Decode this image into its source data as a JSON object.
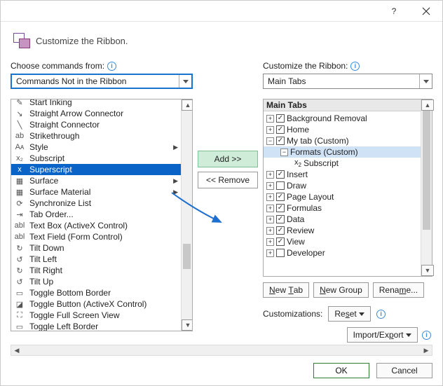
{
  "header": {
    "title": "Customize the Ribbon."
  },
  "labels": {
    "choose": "Choose commands from:",
    "customize": "Customize the Ribbon:"
  },
  "combos": {
    "commands": "Commands Not in the Ribbon",
    "target": "Main Tabs"
  },
  "commands": [
    {
      "label": "Start Inking",
      "icon": "✎"
    },
    {
      "label": "Straight Arrow Connector",
      "icon": "↘"
    },
    {
      "label": "Straight Connector",
      "icon": "╲"
    },
    {
      "label": "Strikethrough",
      "icon": "ab"
    },
    {
      "label": "Style",
      "icon": "Aᴀ",
      "submenu": true
    },
    {
      "label": "Subscript",
      "icon": "x₂"
    },
    {
      "label": "Superscript",
      "icon": "x",
      "selected": true
    },
    {
      "label": "Surface",
      "icon": "▦",
      "submenu": true
    },
    {
      "label": "Surface Material",
      "icon": "▦",
      "submenu": true
    },
    {
      "label": "Synchronize List",
      "icon": "⟳"
    },
    {
      "label": "Tab Order...",
      "icon": "⇥"
    },
    {
      "label": "Text Box (ActiveX Control)",
      "icon": "abl"
    },
    {
      "label": "Text Field (Form Control)",
      "icon": "abl"
    },
    {
      "label": "Tilt Down",
      "icon": "↻"
    },
    {
      "label": "Tilt Left",
      "icon": "↺"
    },
    {
      "label": "Tilt Right",
      "icon": "↻"
    },
    {
      "label": "Tilt Up",
      "icon": "↺"
    },
    {
      "label": "Toggle Bottom Border",
      "icon": "▭"
    },
    {
      "label": "Toggle Button (ActiveX Control)",
      "icon": "◪"
    },
    {
      "label": "Toggle Full Screen View",
      "icon": "⛶"
    },
    {
      "label": "Toggle Left Border",
      "icon": "▭"
    }
  ],
  "mid": {
    "add": "Add >>",
    "remove": "<< Remove"
  },
  "tree_header": "Main Tabs",
  "tree": [
    {
      "exp": "+",
      "chk": true,
      "label": "Background Removal",
      "indent": 0
    },
    {
      "exp": "+",
      "chk": true,
      "label": "Home",
      "indent": 0
    },
    {
      "exp": "−",
      "chk": true,
      "label": "My tab (Custom)",
      "indent": 0
    },
    {
      "exp": "−",
      "label": "Formats (Custom)",
      "indent": 1,
      "selected": true
    },
    {
      "icon": "x₂",
      "label": "Subscript",
      "indent": 2
    },
    {
      "exp": "+",
      "chk": true,
      "label": "Insert",
      "indent": 0
    },
    {
      "exp": "+",
      "chk": false,
      "label": "Draw",
      "indent": 0
    },
    {
      "exp": "+",
      "chk": true,
      "label": "Page Layout",
      "indent": 0
    },
    {
      "exp": "+",
      "chk": true,
      "label": "Formulas",
      "indent": 0
    },
    {
      "exp": "+",
      "chk": true,
      "label": "Data",
      "indent": 0
    },
    {
      "exp": "+",
      "chk": true,
      "label": "Review",
      "indent": 0
    },
    {
      "exp": "+",
      "chk": true,
      "label": "View",
      "indent": 0
    },
    {
      "exp": "+",
      "chk": false,
      "label": "Developer",
      "indent": 0
    }
  ],
  "buttons": {
    "newtab": "New Tab",
    "newgroup": "New Group",
    "rename": "Rename...",
    "reset": "Reset",
    "import": "Import/Export",
    "ok": "OK",
    "cancel": "Cancel"
  },
  "captions": {
    "customizations": "Customizations:"
  }
}
